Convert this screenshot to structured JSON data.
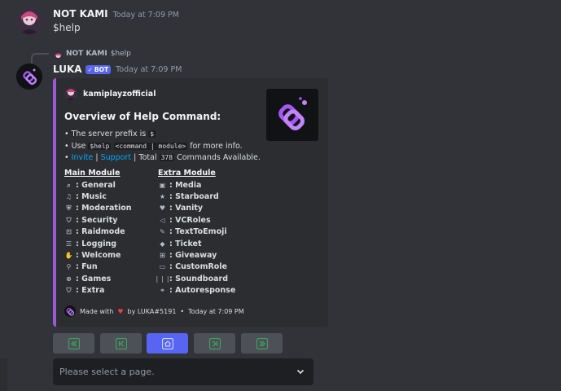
{
  "messages": [
    {
      "author": "NOT KAMI",
      "timestamp": "Today at 7:09 PM",
      "content": "$help"
    }
  ],
  "reply": {
    "author": "NOT KAMI",
    "content": "$help"
  },
  "bot_message": {
    "author": "LUKA",
    "tag": "BOT",
    "timestamp": "Today at 7:09 PM"
  },
  "embed": {
    "author_name": "kamiplayzofficial",
    "title": "Overview of Help Command:",
    "desc_prefix_line": "• The server prefix is ",
    "prefix_code": "$",
    "desc_use_prefix": "• Use ",
    "use_code_1": "$help",
    "use_code_2": "<command | module>",
    "desc_use_suffix": " for more info.",
    "bullet": "•",
    "invite": "Invite",
    "sep": "|",
    "support": "Support",
    "total_label": "Total",
    "total_count": "378",
    "total_suffix": "Commands Available.",
    "main_module": {
      "name": "Main Module",
      "items": [
        {
          "icon": "search-icon",
          "glyph": "⌕",
          "label": ": General"
        },
        {
          "icon": "music-icon",
          "glyph": "♫",
          "label": ": Music"
        },
        {
          "icon": "shield-icon",
          "glyph": "⛨",
          "label": ": Moderation"
        },
        {
          "icon": "security-icon",
          "glyph": "⛉",
          "label": ": Security"
        },
        {
          "icon": "lock-icon",
          "glyph": "⊡",
          "label": ": Raidmode"
        },
        {
          "icon": "log-icon",
          "glyph": "☰",
          "label": ": Logging"
        },
        {
          "icon": "welcome-icon",
          "glyph": "✋",
          "label": ": Welcome"
        },
        {
          "icon": "balloon-icon",
          "glyph": "⚲",
          "label": ": Fun"
        },
        {
          "icon": "gamepad-icon",
          "glyph": "⊕",
          "label": ": Games"
        },
        {
          "icon": "extra-icon",
          "glyph": "⛉",
          "label": ": Extra"
        }
      ]
    },
    "extra_module": {
      "name": "Extra Module",
      "items": [
        {
          "icon": "image-icon",
          "glyph": "▣",
          "label": ": Media"
        },
        {
          "icon": "star-icon",
          "glyph": "★",
          "label": ": Starboard"
        },
        {
          "icon": "heart-icon",
          "glyph": "♥",
          "label": ": Vanity"
        },
        {
          "icon": "roles-icon",
          "glyph": "◁",
          "label": ": VCRoles"
        },
        {
          "icon": "emoji-icon",
          "glyph": "✎",
          "label": ": TextToEmoji"
        },
        {
          "icon": "ticket-icon",
          "glyph": "◆",
          "label": ": Ticket"
        },
        {
          "icon": "gift-icon",
          "glyph": "⊞",
          "label": ": Giveaway"
        },
        {
          "icon": "customrole-icon",
          "glyph": "▭",
          "label": ": CustomRole"
        },
        {
          "icon": "soundboard-icon",
          "glyph": "❘❘❘",
          "label": ": Soundboard"
        },
        {
          "icon": "link-icon",
          "glyph": "⚭",
          "label": ": Autoresponse"
        }
      ]
    },
    "footer": {
      "made_with": "Made with",
      "by": "by LUKA#5191",
      "dot": "•",
      "timestamp": "Today at 7:09 PM"
    }
  },
  "buttons": [
    {
      "name": "first-page-button",
      "icon": "double-arrow-left-icon"
    },
    {
      "name": "previous-page-button",
      "icon": "skip-back-icon"
    },
    {
      "name": "home-button",
      "icon": "home-icon"
    },
    {
      "name": "next-page-button",
      "icon": "skip-forward-icon"
    },
    {
      "name": "last-page-button",
      "icon": "double-arrow-right-icon"
    }
  ],
  "select": {
    "placeholder": "Please select a page."
  },
  "colors": {
    "accent": "#9b59d6",
    "blurple": "#5865f2",
    "link": "#00a8fc",
    "button_icon_green": "#3ba55c",
    "button_icon_blue": "#c9d4ff"
  }
}
